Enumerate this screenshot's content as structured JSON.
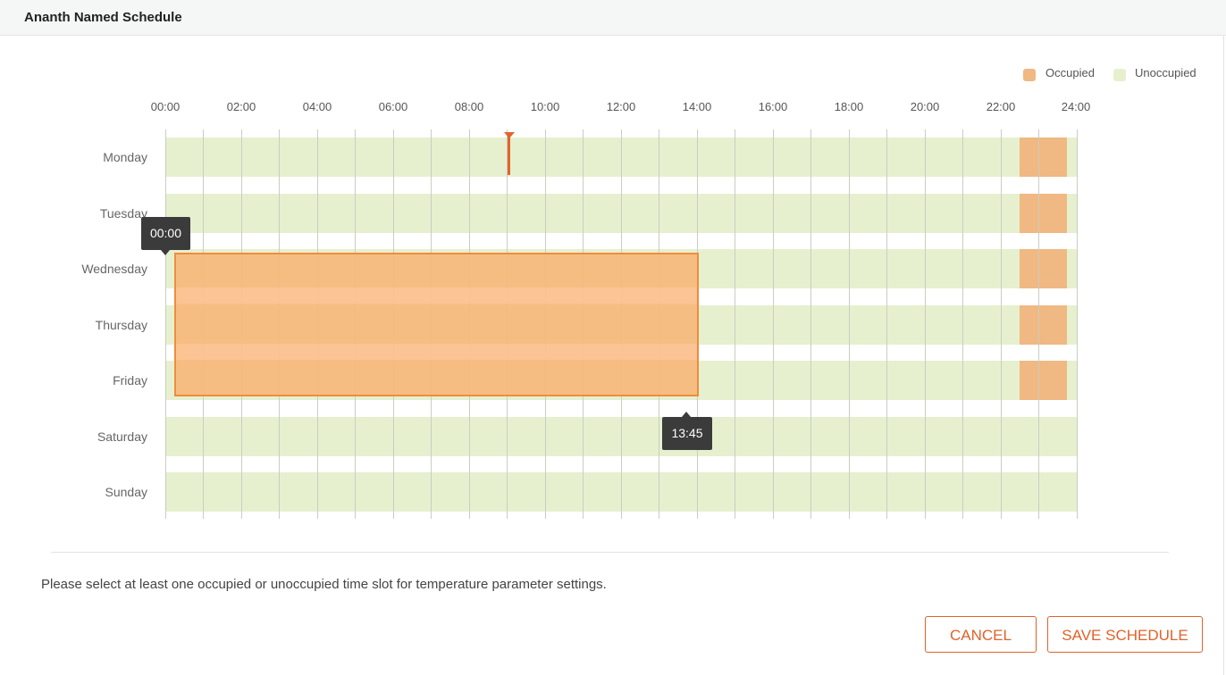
{
  "header": {
    "title": "Ananth Named Schedule"
  },
  "legend": [
    {
      "label": "Occupied",
      "color": "#f0b882"
    },
    {
      "label": "Unoccupied",
      "color": "#e6f0cf"
    }
  ],
  "timeline": {
    "ticks": [
      "00:00",
      "02:00",
      "04:00",
      "06:00",
      "08:00",
      "10:00",
      "12:00",
      "14:00",
      "16:00",
      "18:00",
      "20:00",
      "22:00",
      "24:00"
    ],
    "days": [
      "Monday",
      "Tuesday",
      "Wednesday",
      "Thursday",
      "Friday",
      "Saturday",
      "Sunday"
    ],
    "selection": {
      "start_label": "00:00",
      "end_label": "13:45"
    }
  },
  "footer": {
    "hint": "Please select at least one occupied or unoccupied time slot for temperature parameter settings.",
    "cancel_label": "CANCEL",
    "save_label": "SAVE SCHEDULE"
  },
  "colors": {
    "accent": "#e0622a",
    "occupied": "#f0b882",
    "unoccupied": "#e6f0cf",
    "selection": "#f7b77a"
  }
}
